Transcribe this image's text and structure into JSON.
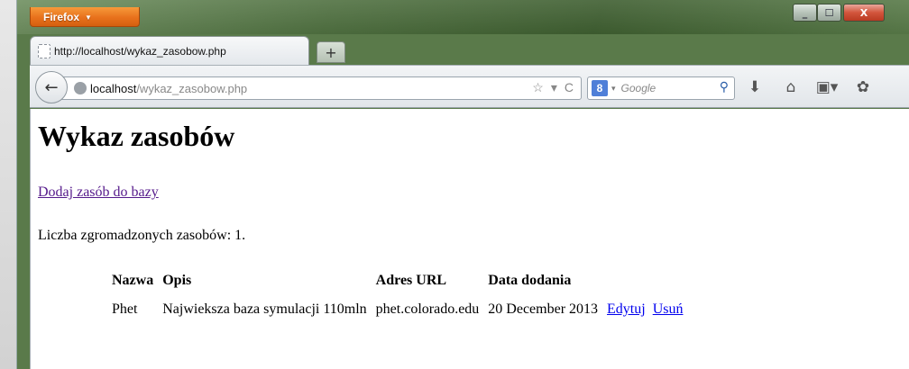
{
  "browser": {
    "menu_button_label": "Firefox",
    "menu_caret": "▼",
    "tab_title": "http://localhost/wykaz_zasobow.php",
    "new_tab_glyph": "+",
    "url_host": "localhost",
    "url_path": "/wykaz_zasobow.php",
    "search_engine_badge": "8",
    "search_placeholder": "Google",
    "window_controls": {
      "minimize": "_",
      "maximize": "☐",
      "close": "X"
    },
    "icons": [
      "back-icon",
      "globe-icon",
      "bookmark-star-icon",
      "dropdown-icon",
      "reload-icon",
      "search-icon",
      "download-icon",
      "home-icon",
      "bookmarks-menu-icon",
      "addon-icon"
    ]
  },
  "page": {
    "title": "Wykaz zasobów",
    "add_link": "Dodaj zasób do bazy",
    "count_text": "Liczba zgromadzonych zasobów: 1.",
    "table": {
      "headers": [
        "Nazwa",
        "Opis",
        "Adres URL",
        "Data dodania"
      ],
      "rows": [
        {
          "nazwa": "Phet",
          "opis": "Najwieksza baza symulacji 110mln",
          "adres_url": "phet.colorado.edu",
          "data_dodania": "20 December 2013",
          "edit_label": "Edytuj",
          "delete_label": "Usuń"
        }
      ]
    }
  },
  "colors": {
    "firefox_button": "#e8711c",
    "visited_link": "#551a8b",
    "link": "#0000ee",
    "close_button": "#d2553c"
  }
}
